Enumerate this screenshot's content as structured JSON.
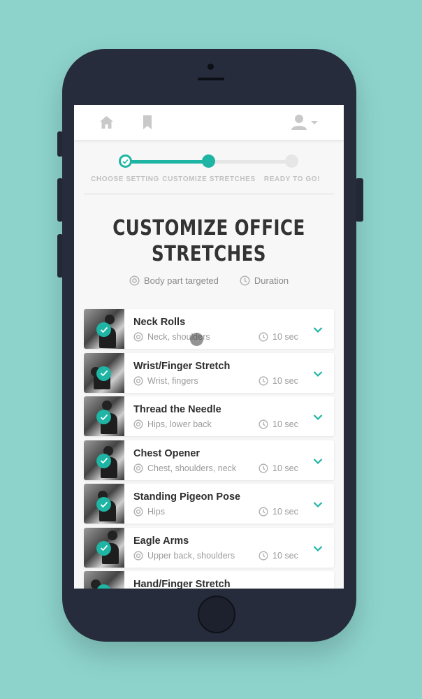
{
  "nav": {
    "home_icon": "home-icon",
    "bookmark_icon": "bookmark-icon",
    "user_icon": "user-icon"
  },
  "stepper": {
    "steps": [
      {
        "label": "CHOOSE SETTING",
        "state": "done"
      },
      {
        "label": "CUSTOMIZE STRETCHES",
        "state": "current"
      },
      {
        "label": "READY TO GO!",
        "state": "upcoming"
      }
    ],
    "accent": "#1eb5a4"
  },
  "page": {
    "title_line1": "CUSTOMIZE OFFICE",
    "title_line2": "STRETCHES",
    "legend_body": "Body part targeted",
    "legend_duration": "Duration"
  },
  "stretches": [
    {
      "title": "Neck Rolls",
      "body": "Neck, shoulders",
      "duration": "10 sec",
      "selected": true
    },
    {
      "title": "Wrist/Finger Stretch",
      "body": "Wrist, fingers",
      "duration": "10 sec",
      "selected": true
    },
    {
      "title": "Thread the Needle",
      "body": "Hips, lower back",
      "duration": "10 sec",
      "selected": true
    },
    {
      "title": "Chest Opener",
      "body": "Chest, shoulders, neck",
      "duration": "10 sec",
      "selected": true
    },
    {
      "title": "Standing Pigeon Pose",
      "body": "Hips",
      "duration": "10 sec",
      "selected": true
    },
    {
      "title": "Eagle Arms",
      "body": "Upper back, shoulders",
      "duration": "10 sec",
      "selected": true
    },
    {
      "title": "Hand/Finger Stretch",
      "body": "",
      "duration": "",
      "selected": true
    }
  ],
  "colors": {
    "background": "#8dd3cc",
    "phone": "#262c3b",
    "accent": "#1eb5a4"
  }
}
